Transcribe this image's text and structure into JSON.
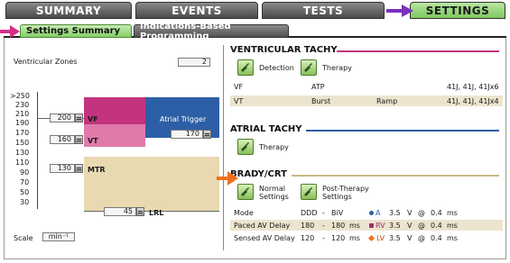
{
  "top_tabs": [
    {
      "label": "SUMMARY"
    },
    {
      "label": "EVENTS"
    },
    {
      "label": "TESTS"
    },
    {
      "label": "SETTINGS"
    }
  ],
  "sub_tabs": [
    {
      "label": "Settings Summary"
    },
    {
      "label": "Indications-Based Programming"
    }
  ],
  "colors": {
    "accent_green": "#86cf68",
    "vf_zone": "#c2357e",
    "vt_zone": "#e07aab",
    "mtr_zone": "#e8d9b0",
    "atrial_trigger": "#2d5fa6",
    "ventricular_line": "#c2357e",
    "atrial_line": "#2d5fa6",
    "brady_line": "#c9b88a",
    "arrow_purple": "#7b2fbf",
    "arrow_pink": "#d6308a",
    "arrow_orange": "#f07020"
  },
  "left": {
    "zones_label": "Ventricular Zones",
    "zones_value": "2",
    "scale": [
      ">250",
      "230",
      "210",
      "190",
      "170",
      "150",
      "130",
      "110",
      "90",
      "70",
      "50",
      "30"
    ],
    "vf": {
      "value": "200",
      "label": "VF"
    },
    "vt": {
      "value": "160",
      "label": "VT"
    },
    "mtr": {
      "value": "130",
      "label": "MTR"
    },
    "atrial_trigger": {
      "label": "Atrial Trigger",
      "value": "170"
    },
    "lrl": {
      "value": "45",
      "label": "LRL"
    },
    "scale_label": "Scale",
    "scale_value": "min⁻¹"
  },
  "ventricular": {
    "title": "VENTRICULAR TACHY",
    "detection_label": "Detection",
    "therapy_label": "Therapy",
    "rows": [
      {
        "zone": "VF",
        "detail": "ATP",
        "extra": "",
        "shocks": "41J, 41J, 41Jx6"
      },
      {
        "zone": "VT",
        "detail": "Burst",
        "extra": "Ramp",
        "shocks": "41J, 41J, 41Jx4"
      }
    ]
  },
  "atrial": {
    "title": "ATRIAL TACHY",
    "therapy_label": "Therapy"
  },
  "brady": {
    "title": "BRADY/CRT",
    "normal_label_1": "Normal",
    "normal_label_2": "Settings",
    "post_label_1": "Post-Therapy",
    "post_label_2": "Settings",
    "rows": [
      {
        "name": "Mode",
        "v1": "DDD",
        "dash": "-",
        "v2": "BiV",
        "lead": "A",
        "amp": "3.5",
        "unit": "V",
        "at": "@",
        "pw": "0.4",
        "ms": "ms"
      },
      {
        "name": "Paced AV Delay",
        "v1": "180",
        "dash": "-",
        "v2": "180",
        "v2u": "ms",
        "lead": "RV",
        "amp": "3.5",
        "unit": "V",
        "at": "@",
        "pw": "0.4",
        "ms": "ms"
      },
      {
        "name": "Sensed AV Delay",
        "v1": "120",
        "dash": "-",
        "v2": "120",
        "v2u": "ms",
        "lead": "LV",
        "amp": "3.5",
        "unit": "V",
        "at": "@",
        "pw": "0.4",
        "ms": "ms"
      }
    ]
  }
}
